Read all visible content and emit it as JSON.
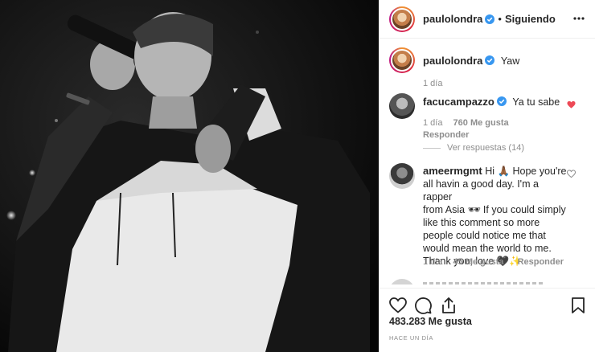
{
  "header": {
    "username": "paulolondra",
    "separator": "•",
    "follow_status": "Siguiendo",
    "more_icon": "more-horizontal-icon"
  },
  "caption": {
    "username": "paulolondra",
    "text": "Yaw",
    "time": "1 día"
  },
  "comments": [
    {
      "username": "facucampazzo",
      "text": "Ya tu sabe",
      "time": "1 día",
      "likes": "760 Me gusta",
      "reply": "Responder",
      "view_replies": "Ver respuestas (14)",
      "liked": true,
      "heart_color": "#ed4956"
    },
    {
      "username": "ameermgmt",
      "text_lines": [
        "Hi 🙏🏾 Hope you're",
        "all havin a good day. I'm a rapper",
        "from Asia 🕶 If you could simply",
        "like this comment so more",
        "people could notice me that",
        "would mean the world to me.",
        "Thank you, love 🖤✨"
      ],
      "time": "1 día",
      "likes": "45 Me gusta",
      "reply": "Responder",
      "liked": false
    }
  ],
  "actions": {
    "like_icon": "heart-icon",
    "comment_icon": "comment-icon",
    "share_icon": "share-icon",
    "save_icon": "bookmark-icon"
  },
  "likes_count": "483.283 Me gusta",
  "posted": "HACE UN DÍA",
  "colors": {
    "verified": "#3897f0",
    "liked_heart": "#ed4956",
    "secondary_text": "#8e8e8e"
  }
}
